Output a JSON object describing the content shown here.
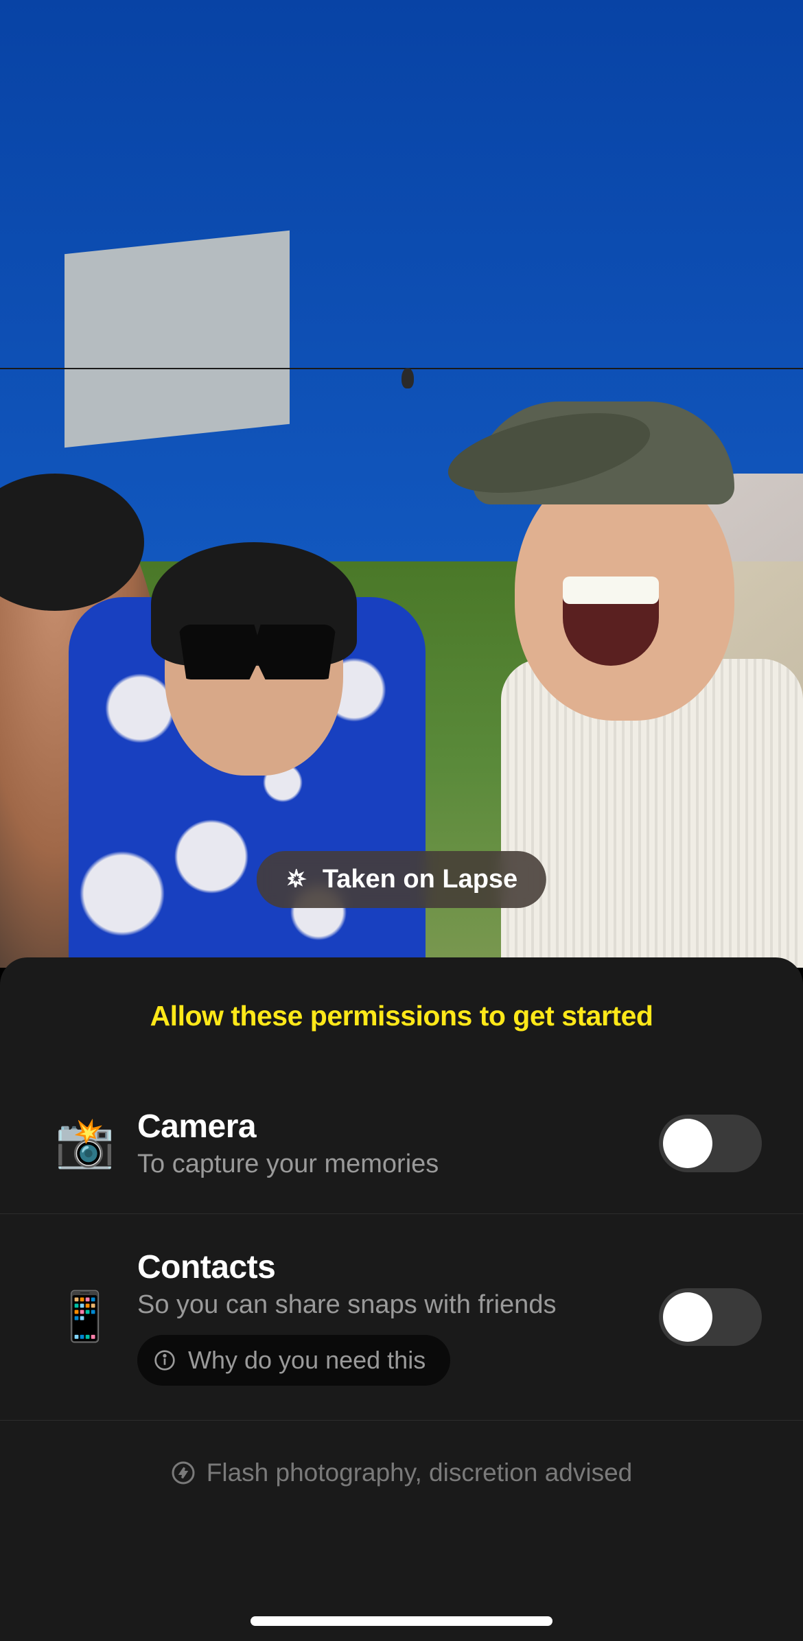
{
  "photo_badge": {
    "label": "Taken on Lapse",
    "icon": "sparkle-icon"
  },
  "panel": {
    "title": "Allow these permissions to get started"
  },
  "permissions": [
    {
      "icon": "📸",
      "title": "Camera",
      "subtitle": "To capture your memories",
      "enabled": false
    },
    {
      "icon": "📱",
      "title": "Contacts",
      "subtitle": "So you can share snaps with friends",
      "enabled": false,
      "why_label": "Why do you need this"
    }
  ],
  "footer": {
    "warning": "Flash photography, discretion advised"
  }
}
